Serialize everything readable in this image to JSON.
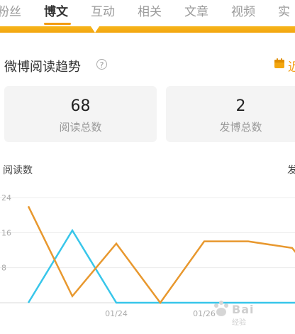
{
  "tabs": [
    {
      "label": "粉丝",
      "active": false
    },
    {
      "label": "博文",
      "active": true
    },
    {
      "label": "互动",
      "active": false
    },
    {
      "label": "相关",
      "active": false
    },
    {
      "label": "文章",
      "active": false
    },
    {
      "label": "视频",
      "active": false
    },
    {
      "label": "实",
      "active": false
    }
  ],
  "section": {
    "title": "微博阅读趋势",
    "help": "?",
    "calendar_label": "近"
  },
  "stats": [
    {
      "value": "68",
      "label": "阅读总数"
    },
    {
      "value": "2",
      "label": "发博总数"
    }
  ],
  "legend": {
    "left": "阅读数",
    "right": "发"
  },
  "colors": {
    "accent": "#f3a60f",
    "orange_series": "#e8982e",
    "blue_series": "#38c6ea"
  },
  "chart_data": {
    "type": "line",
    "x": [
      "01/22",
      "01/23",
      "01/24",
      "01/25",
      "01/26",
      "01/27",
      "01/28",
      "01/29"
    ],
    "x_tick_labels": [
      "",
      "",
      "01/24",
      "",
      "01/26",
      "",
      "",
      ""
    ],
    "y_tick_labels": [
      "24",
      "16",
      "8",
      ""
    ],
    "y_ticks": [
      24,
      16,
      8,
      0
    ],
    "ylim": [
      0,
      24
    ],
    "series": [
      {
        "values": [
          0,
          16.5,
          0,
          0,
          0,
          0,
          0,
          0
        ],
        "color": "#38c6ea"
      },
      {
        "values": [
          22,
          1.5,
          13.5,
          0,
          14,
          14,
          12.5,
          0
        ],
        "color": "#e8982e"
      }
    ],
    "grid": true
  },
  "watermark": {
    "text": "Bai",
    "suffix": "经验"
  }
}
